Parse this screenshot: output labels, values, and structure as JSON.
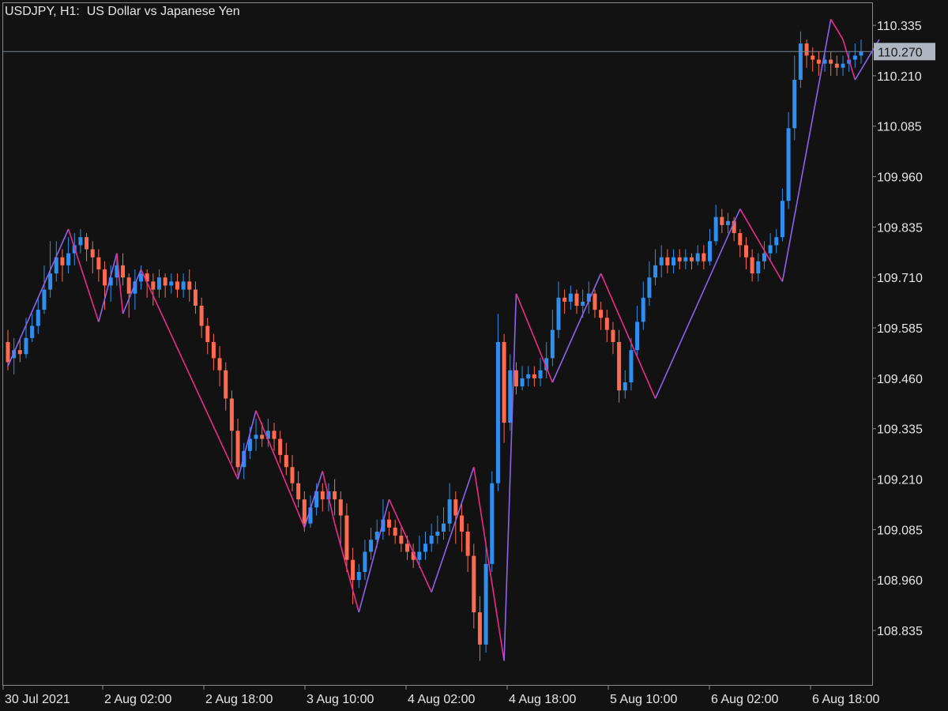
{
  "header": {
    "title": "USDJPY, H1:  US Dollar vs Japanese Yen"
  },
  "colors": {
    "background": "#121212",
    "frame": "#8a8a8a",
    "text": "#e6e6e6",
    "bull": "#2e8ff0",
    "bear": "#ff6a50",
    "zigzag_up": "#8a64f0",
    "zigzag_down": "#f02a8a",
    "price_line": "#7a8594",
    "price_tag": "#aeb6c2"
  },
  "chart_data": {
    "type": "candlestick",
    "symbol": "USDJPY",
    "timeframe": "H1",
    "title": "USDJPY, H1:  US Dollar vs Japanese Yen",
    "current_price": "110.270",
    "ylim": [
      108.7,
      110.39
    ],
    "y_ticks": [
      "110.335",
      "110.210",
      "110.085",
      "109.960",
      "109.835",
      "109.710",
      "109.585",
      "109.460",
      "109.335",
      "109.210",
      "109.085",
      "108.960",
      "108.835"
    ],
    "x_ticks": [
      "30 Jul 2021",
      "2 Aug 02:00",
      "2 Aug 18:00",
      "3 Aug 10:00",
      "4 Aug 02:00",
      "4 Aug 18:00",
      "5 Aug 10:00",
      "6 Aug 02:00",
      "6 Aug 18:00"
    ],
    "grid": false,
    "candles": [
      [
        109.55,
        109.5,
        109.58,
        109.48
      ],
      [
        109.51,
        109.53,
        109.56,
        109.47
      ],
      [
        109.53,
        109.52,
        109.56,
        109.5
      ],
      [
        109.52,
        109.56,
        109.61,
        109.51
      ],
      [
        109.56,
        109.59,
        109.62,
        109.55
      ],
      [
        109.59,
        109.63,
        109.66,
        109.57
      ],
      [
        109.63,
        109.68,
        109.74,
        109.62
      ],
      [
        109.68,
        109.72,
        109.8,
        109.66
      ],
      [
        109.72,
        109.76,
        109.8,
        109.7
      ],
      [
        109.76,
        109.74,
        109.78,
        109.7
      ],
      [
        109.74,
        109.77,
        109.81,
        109.72
      ],
      [
        109.77,
        109.79,
        109.82,
        109.74
      ],
      [
        109.79,
        109.81,
        109.83,
        109.77
      ],
      [
        109.81,
        109.78,
        109.82,
        109.75
      ],
      [
        109.78,
        109.76,
        109.8,
        109.72
      ],
      [
        109.76,
        109.73,
        109.78,
        109.7
      ],
      [
        109.73,
        109.69,
        109.75,
        109.63
      ],
      [
        109.69,
        109.71,
        109.74,
        109.65
      ],
      [
        109.71,
        109.74,
        109.76,
        109.69
      ],
      [
        109.74,
        109.71,
        109.77,
        109.69
      ],
      [
        109.71,
        109.67,
        109.72,
        109.61
      ],
      [
        109.67,
        109.7,
        109.73,
        109.63
      ],
      [
        109.7,
        109.72,
        109.74,
        109.68
      ],
      [
        109.72,
        109.7,
        109.73,
        109.66
      ],
      [
        109.7,
        109.68,
        109.72,
        109.64
      ],
      [
        109.68,
        109.71,
        109.73,
        109.66
      ],
      [
        109.71,
        109.69,
        109.72,
        109.66
      ],
      [
        109.69,
        109.7,
        109.72,
        109.67
      ],
      [
        109.7,
        109.68,
        109.72,
        109.66
      ],
      [
        109.68,
        109.7,
        109.72,
        109.66
      ],
      [
        109.7,
        109.68,
        109.73,
        109.65
      ],
      [
        109.68,
        109.64,
        109.7,
        109.62
      ],
      [
        109.64,
        109.59,
        109.66,
        109.56
      ],
      [
        109.59,
        109.55,
        109.61,
        109.52
      ],
      [
        109.55,
        109.51,
        109.57,
        109.48
      ],
      [
        109.51,
        109.48,
        109.54,
        109.44
      ],
      [
        109.48,
        109.41,
        109.5,
        109.38
      ],
      [
        109.41,
        109.33,
        109.43,
        109.25
      ],
      [
        109.33,
        109.24,
        109.36,
        109.22
      ],
      [
        109.24,
        109.28,
        109.3,
        109.21
      ],
      [
        109.28,
        109.31,
        109.34,
        109.26
      ],
      [
        109.31,
        109.32,
        109.36,
        109.28
      ],
      [
        109.32,
        109.31,
        109.35,
        109.29
      ],
      [
        109.31,
        109.33,
        109.36,
        109.29
      ],
      [
        109.33,
        109.31,
        109.35,
        109.28
      ],
      [
        109.31,
        109.27,
        109.33,
        109.25
      ],
      [
        109.27,
        109.24,
        109.3,
        109.22
      ],
      [
        109.24,
        109.2,
        109.27,
        109.18
      ],
      [
        109.2,
        109.16,
        109.23,
        109.14
      ],
      [
        109.16,
        109.1,
        109.18,
        109.08
      ],
      [
        109.1,
        109.14,
        109.17,
        109.09
      ],
      [
        109.14,
        109.18,
        109.2,
        109.12
      ],
      [
        109.18,
        109.16,
        109.2,
        109.13
      ],
      [
        109.16,
        109.18,
        109.2,
        109.13
      ],
      [
        109.18,
        109.16,
        109.21,
        109.12
      ],
      [
        109.16,
        109.12,
        109.18,
        109.05
      ],
      [
        109.12,
        109.01,
        109.15,
        108.98
      ],
      [
        109.01,
        108.96,
        109.04,
        108.9
      ],
      [
        108.96,
        108.98,
        109.0,
        108.94
      ],
      [
        108.98,
        109.03,
        109.06,
        108.96
      ],
      [
        109.03,
        109.06,
        109.09,
        109.01
      ],
      [
        109.06,
        109.08,
        109.11,
        109.04
      ],
      [
        109.08,
        109.11,
        109.16,
        109.06
      ],
      [
        109.11,
        109.09,
        109.13,
        109.07
      ],
      [
        109.09,
        109.07,
        109.11,
        109.05
      ],
      [
        109.07,
        109.05,
        109.09,
        109.03
      ],
      [
        109.05,
        109.03,
        109.07,
        109.01
      ],
      [
        109.03,
        109.01,
        109.05,
        108.99
      ],
      [
        109.01,
        109.03,
        109.07,
        108.99
      ],
      [
        109.03,
        109.05,
        109.08,
        109.01
      ],
      [
        109.05,
        109.07,
        109.1,
        109.03
      ],
      [
        109.07,
        109.08,
        109.12,
        109.05
      ],
      [
        109.08,
        109.1,
        109.14,
        109.06
      ],
      [
        109.1,
        109.16,
        109.2,
        109.08
      ],
      [
        109.16,
        109.12,
        109.18,
        109.05
      ],
      [
        109.12,
        109.08,
        109.15,
        109.03
      ],
      [
        109.08,
        109.02,
        109.1,
        108.98
      ],
      [
        109.02,
        108.88,
        109.05,
        108.84
      ],
      [
        108.88,
        108.8,
        108.92,
        108.76
      ],
      [
        108.8,
        109.0,
        109.05,
        108.78
      ],
      [
        109.0,
        109.2,
        109.23,
        108.98
      ],
      [
        109.2,
        109.55,
        109.62,
        109.18
      ],
      [
        109.55,
        109.35,
        109.57,
        109.3
      ],
      [
        109.35,
        109.48,
        109.52,
        109.33
      ],
      [
        109.48,
        109.44,
        109.5,
        109.42
      ],
      [
        109.44,
        109.46,
        109.49,
        109.43
      ],
      [
        109.46,
        109.47,
        109.49,
        109.44
      ],
      [
        109.47,
        109.46,
        109.49,
        109.44
      ],
      [
        109.46,
        109.48,
        109.51,
        109.44
      ],
      [
        109.48,
        109.51,
        109.55,
        109.46
      ],
      [
        109.51,
        109.58,
        109.63,
        109.49
      ],
      [
        109.58,
        109.66,
        109.7,
        109.56
      ],
      [
        109.66,
        109.65,
        109.68,
        109.62
      ],
      [
        109.65,
        109.67,
        109.69,
        109.63
      ],
      [
        109.67,
        109.64,
        109.68,
        109.62
      ],
      [
        109.64,
        109.65,
        109.68,
        109.61
      ],
      [
        109.65,
        109.67,
        109.7,
        109.62
      ],
      [
        109.67,
        109.63,
        109.68,
        109.61
      ],
      [
        109.63,
        109.61,
        109.65,
        109.58
      ],
      [
        109.61,
        109.58,
        109.63,
        109.55
      ],
      [
        109.58,
        109.55,
        109.6,
        109.52
      ],
      [
        109.55,
        109.43,
        109.58,
        109.4
      ],
      [
        109.43,
        109.45,
        109.48,
        109.41
      ],
      [
        109.45,
        109.53,
        109.56,
        109.43
      ],
      [
        109.53,
        109.6,
        109.64,
        109.51
      ],
      [
        109.6,
        109.66,
        109.7,
        109.58
      ],
      [
        109.66,
        109.71,
        109.75,
        109.64
      ],
      [
        109.71,
        109.74,
        109.78,
        109.69
      ],
      [
        109.74,
        109.76,
        109.79,
        109.71
      ],
      [
        109.76,
        109.74,
        109.78,
        109.72
      ],
      [
        109.74,
        109.76,
        109.78,
        109.72
      ],
      [
        109.76,
        109.75,
        109.78,
        109.73
      ],
      [
        109.75,
        109.76,
        109.78,
        109.73
      ],
      [
        109.76,
        109.75,
        109.77,
        109.73
      ],
      [
        109.75,
        109.77,
        109.79,
        109.74
      ],
      [
        109.77,
        109.75,
        109.79,
        109.73
      ],
      [
        109.75,
        109.8,
        109.83,
        109.74
      ],
      [
        109.8,
        109.86,
        109.89,
        109.79
      ],
      [
        109.86,
        109.84,
        109.88,
        109.82
      ],
      [
        109.84,
        109.85,
        109.87,
        109.82
      ],
      [
        109.85,
        109.82,
        109.86,
        109.8
      ],
      [
        109.82,
        109.79,
        109.83,
        109.76
      ],
      [
        109.79,
        109.76,
        109.81,
        109.73
      ],
      [
        109.76,
        109.72,
        109.78,
        109.7
      ],
      [
        109.72,
        109.75,
        109.77,
        109.7
      ],
      [
        109.75,
        109.77,
        109.8,
        109.73
      ],
      [
        109.77,
        109.79,
        109.82,
        109.75
      ],
      [
        109.79,
        109.81,
        109.83,
        109.77
      ],
      [
        109.81,
        109.9,
        109.93,
        109.8
      ],
      [
        109.9,
        110.08,
        110.12,
        109.88
      ],
      [
        110.08,
        110.2,
        110.26,
        110.05
      ],
      [
        110.2,
        110.29,
        110.32,
        110.18
      ],
      [
        110.29,
        110.26,
        110.3,
        110.23
      ],
      [
        110.26,
        110.25,
        110.28,
        110.22
      ],
      [
        110.25,
        110.24,
        110.27,
        110.21
      ],
      [
        110.24,
        110.25,
        110.27,
        110.22
      ],
      [
        110.25,
        110.24,
        110.27,
        110.21
      ],
      [
        110.24,
        110.23,
        110.26,
        110.21
      ],
      [
        110.23,
        110.24,
        110.26,
        110.21
      ],
      [
        110.24,
        110.25,
        110.27,
        110.22
      ],
      [
        110.25,
        110.26,
        110.29,
        110.23
      ],
      [
        110.26,
        110.27,
        110.3,
        110.24
      ]
    ],
    "zigzag": [
      [
        0,
        109.49
      ],
      [
        10,
        109.83
      ],
      [
        15,
        109.6
      ],
      [
        18,
        109.77
      ],
      [
        19,
        109.62
      ],
      [
        22,
        109.73
      ],
      [
        38,
        109.21
      ],
      [
        41,
        109.38
      ],
      [
        49,
        109.09
      ],
      [
        52,
        109.23
      ],
      [
        54,
        109.1
      ],
      [
        58,
        108.88
      ],
      [
        63,
        109.16
      ],
      [
        70,
        108.93
      ],
      [
        77,
        109.24
      ],
      [
        82,
        108.76
      ],
      [
        84,
        109.67
      ],
      [
        90,
        109.45
      ],
      [
        98,
        109.72
      ],
      [
        107,
        109.41
      ],
      [
        121,
        109.88
      ],
      [
        128,
        109.7
      ],
      [
        136,
        110.35
      ],
      [
        138,
        110.3
      ],
      [
        140,
        110.2
      ],
      [
        144,
        110.3
      ]
    ]
  }
}
